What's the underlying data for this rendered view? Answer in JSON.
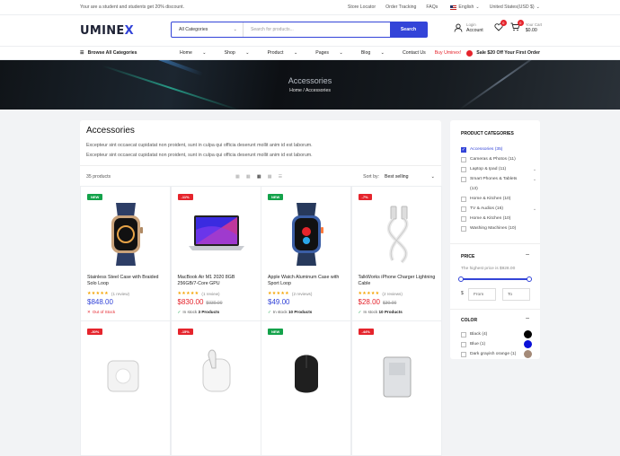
{
  "topbar": {
    "promo": "Your are a student and students get 20% discount.",
    "links": [
      "Store Locator",
      "Order Tracking",
      "FAQs"
    ],
    "language": "English",
    "currency": "United States(USD $)"
  },
  "header": {
    "logo_main": "UMINE",
    "logo_accent": "X",
    "search_category": "All Categories",
    "search_placeholder": "Search for products...",
    "search_button": "Search",
    "account_small": "Login",
    "account_label": "Account",
    "wishlist_count": "0",
    "cart_count": "0",
    "cart_small": "Your Cart",
    "cart_total": "$0.00"
  },
  "nav": {
    "browse": "Browse All Categories",
    "items": [
      "Home",
      "Shop",
      "Product",
      "Pages",
      "Blog",
      "Contact Us"
    ],
    "buy": "Buy Uminex!",
    "sale": "Sale $20 Off Your First Order"
  },
  "banner": {
    "title": "Accessories",
    "breadcrumb": "Home / Accessories"
  },
  "main": {
    "title": "Accessories",
    "desc1": "Excepteur sint occaecat cupidatat non proident, sunt in culpa qui officia deserunt mollit anim id est laborum.",
    "desc2": "Excepteur sint occaecat cupidatat non proident, sunt in culpa qui officia deserunt mollit anim id est laborum.",
    "count": "35 products",
    "sort_label": "Sort by:",
    "sort_value": "Best selling"
  },
  "products": [
    {
      "tag": "NEW",
      "name": "Stainless Steel Case with Braided Solo Loop",
      "reviews": "(1 review)",
      "price": "$848.00",
      "old": "",
      "stock_prefix": "",
      "stock": "Out of Stock",
      "in_stock": false,
      "img": "watch-blue"
    },
    {
      "tag": "-11%",
      "name": "MacBook Air M1 2020 8GB 256GB/7-Core GPU",
      "reviews": "(1 review)",
      "price": "$830.00",
      "old": "$930.00",
      "stock_prefix": "In stock",
      "stock": "3 Products",
      "in_stock": true,
      "img": "laptop"
    },
    {
      "tag": "NEW",
      "name": "Apple Watch Aluminum Case with Sport Loop",
      "reviews": "(2 reviews)",
      "price": "$49.00",
      "old": "",
      "stock_prefix": "In stock",
      "stock": "10 Products",
      "in_stock": true,
      "img": "watch-sport"
    },
    {
      "tag": "-7%",
      "name": "TalkWorks iPhone Charger Lightning Cable",
      "reviews": "(2 reviews)",
      "price": "$28.00",
      "old": "$30.00",
      "stock_prefix": "In stock",
      "stock": "10 Products",
      "in_stock": true,
      "img": "cable"
    },
    {
      "tag": "-30%",
      "name": "",
      "reviews": "",
      "price": "",
      "old": "",
      "stock_prefix": "",
      "stock": "",
      "in_stock": true,
      "img": "charger"
    },
    {
      "tag": "-15%",
      "name": "",
      "reviews": "",
      "price": "",
      "old": "",
      "stock_prefix": "",
      "stock": "",
      "in_stock": true,
      "img": "airpods"
    },
    {
      "tag": "NEW",
      "name": "",
      "reviews": "",
      "price": "",
      "old": "",
      "stock_prefix": "",
      "stock": "",
      "in_stock": true,
      "img": "mouse"
    },
    {
      "tag": "-44%",
      "name": "",
      "reviews": "",
      "price": "",
      "old": "",
      "stock_prefix": "",
      "stock": "",
      "in_stock": true,
      "img": "powerbank"
    }
  ],
  "sidebar": {
    "cat_title": "PRODUCT CATEGORIES",
    "categories": [
      {
        "label": "Accessories",
        "count": "(35)",
        "active": true,
        "expand": false
      },
      {
        "label": "Cameras & Photos",
        "count": "(11)",
        "active": false,
        "expand": false
      },
      {
        "label": "Laptop & Ipad",
        "count": "(11)",
        "active": false,
        "expand": true
      },
      {
        "label": "Smart Phones & Tablets",
        "count": "",
        "active": false,
        "expand": true
      },
      {
        "label": "(13)",
        "count": "",
        "active": false,
        "expand": false,
        "indent": true
      },
      {
        "label": "Home & Kitchen",
        "count": "(10)",
        "active": false,
        "expand": false
      },
      {
        "label": "TV & Audios",
        "count": "(16)",
        "active": false,
        "expand": true
      },
      {
        "label": "Home & Kitchen",
        "count": "(10)",
        "active": false,
        "expand": false
      },
      {
        "label": "Washing Machines",
        "count": "(10)",
        "active": false,
        "expand": false
      }
    ],
    "price_title": "PRICE",
    "price_note": "The highest price is $928.00",
    "currency": "$",
    "from_ph": "From",
    "to_ph": "To",
    "color_title": "COLOR",
    "colors": [
      {
        "label": "Black (4)",
        "hex": "#000000"
      },
      {
        "label": "Blue (1)",
        "hex": "#0a10d8"
      },
      {
        "label": "Dark grayish orange (1)",
        "hex": "#a48a78"
      }
    ]
  },
  "colors": {
    "accent": "#3344d8",
    "sale": "#e5242c",
    "new": "#13a24a",
    "star": "#f5a300"
  }
}
